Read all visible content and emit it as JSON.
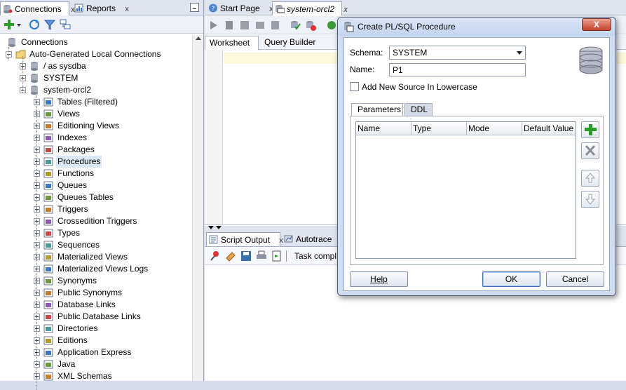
{
  "left_panel": {
    "tabs": [
      {
        "label": "Connections",
        "icon": "connections-icon",
        "active": true
      },
      {
        "label": "Reports",
        "icon": "reports-icon",
        "active": false
      }
    ],
    "tree": {
      "root": "Connections",
      "group": "Auto-Generated Local Connections",
      "connections": [
        "/ as sysdba",
        "SYSTEM",
        "system-orcl2"
      ],
      "children": [
        "Tables (Filtered)",
        "Views",
        "Editioning Views",
        "Indexes",
        "Packages",
        "Procedures",
        "Functions",
        "Queues",
        "Queues Tables",
        "Triggers",
        "Crossedition Triggers",
        "Types",
        "Sequences",
        "Materialized Views",
        "Materialized Views Logs",
        "Synonyms",
        "Public Synonyms",
        "Database Links",
        "Public Database Links",
        "Directories",
        "Editions",
        "Application Express",
        "Java",
        "XML Schemas"
      ],
      "selected": "Procedures"
    }
  },
  "editor": {
    "tabs": [
      {
        "label": "Start Page",
        "icon": "help-icon"
      },
      {
        "label": "system-orcl2",
        "icon": "sql-worksheet-icon"
      }
    ],
    "subtabs": [
      "Worksheet",
      "Query Builder"
    ],
    "output_tabs": [
      "Script Output",
      "Autotrace"
    ],
    "output_status": "Task complete"
  },
  "dialog": {
    "title": "Create PL/SQL Procedure",
    "close_label": "X",
    "schema_label": "Schema:",
    "schema_value": "SYSTEM",
    "name_label": "Name:",
    "name_value": "P1",
    "lowercase_label": "Add New Source In Lowercase",
    "tabs": [
      "Parameters",
      "DDL"
    ],
    "grid_columns": [
      "Name",
      "Type",
      "Mode",
      "Default Value"
    ],
    "buttons": {
      "help": "Help",
      "ok": "OK",
      "cancel": "Cancel"
    }
  },
  "close_glyph": "x",
  "colors": {
    "accent": "#3f6fb5",
    "selection": "#dbe6f6",
    "add_green": "#2a9a2a"
  }
}
